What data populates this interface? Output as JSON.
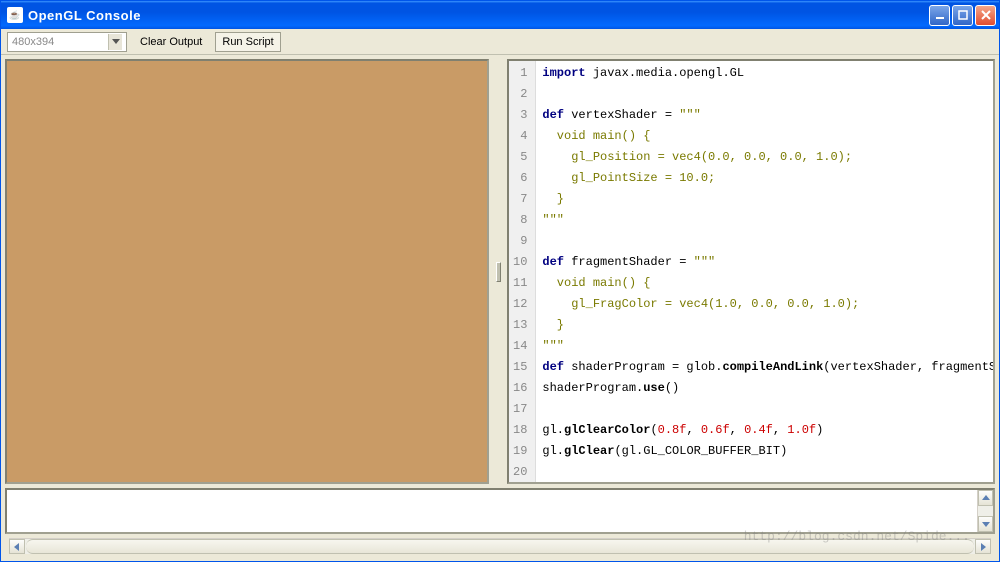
{
  "window": {
    "title": "OpenGL Console",
    "icon": "java-icon"
  },
  "toolbar": {
    "resolution_value": "480x394",
    "clear_label": "Clear Output",
    "run_label": "Run Script"
  },
  "canvas": {
    "bg_color": "#c99b66"
  },
  "code": {
    "lines": [
      {
        "n": 1,
        "segments": [
          {
            "c": "kw",
            "t": "import"
          },
          {
            "c": "",
            "t": " javax.media.opengl.GL"
          }
        ]
      },
      {
        "n": 2,
        "segments": []
      },
      {
        "n": 3,
        "segments": [
          {
            "c": "kw",
            "t": "def"
          },
          {
            "c": "",
            "t": " vertexShader = "
          },
          {
            "c": "str",
            "t": "\"\"\""
          }
        ]
      },
      {
        "n": 4,
        "segments": [
          {
            "c": "str",
            "t": "  void main() {"
          }
        ]
      },
      {
        "n": 5,
        "segments": [
          {
            "c": "str",
            "t": "    gl_Position = vec4(0.0, 0.0, 0.0, 1.0);"
          }
        ]
      },
      {
        "n": 6,
        "segments": [
          {
            "c": "str",
            "t": "    gl_PointSize = 10.0;"
          }
        ]
      },
      {
        "n": 7,
        "segments": [
          {
            "c": "str",
            "t": "  }"
          }
        ]
      },
      {
        "n": 8,
        "segments": [
          {
            "c": "str",
            "t": "\"\"\""
          }
        ]
      },
      {
        "n": 9,
        "segments": []
      },
      {
        "n": 10,
        "segments": [
          {
            "c": "kw",
            "t": "def"
          },
          {
            "c": "",
            "t": " fragmentShader = "
          },
          {
            "c": "str",
            "t": "\"\"\""
          }
        ]
      },
      {
        "n": 11,
        "segments": [
          {
            "c": "str",
            "t": "  void main() {"
          }
        ]
      },
      {
        "n": 12,
        "segments": [
          {
            "c": "str",
            "t": "    gl_FragColor = vec4(1.0, 0.0, 0.0, 1.0);"
          }
        ]
      },
      {
        "n": 13,
        "segments": [
          {
            "c": "str",
            "t": "  }"
          }
        ]
      },
      {
        "n": 14,
        "segments": [
          {
            "c": "str",
            "t": "\"\"\""
          }
        ]
      },
      {
        "n": 15,
        "segments": [
          {
            "c": "kw",
            "t": "def"
          },
          {
            "c": "",
            "t": " shaderProgram = glob."
          },
          {
            "c": "fn",
            "t": "compileAndLink"
          },
          {
            "c": "",
            "t": "(vertexShader, fragmentShader)"
          }
        ]
      },
      {
        "n": 16,
        "segments": [
          {
            "c": "",
            "t": "shaderProgram."
          },
          {
            "c": "fn",
            "t": "use"
          },
          {
            "c": "",
            "t": "()"
          }
        ]
      },
      {
        "n": 17,
        "segments": []
      },
      {
        "n": 18,
        "segments": [
          {
            "c": "",
            "t": "gl."
          },
          {
            "c": "fn",
            "t": "glClearColor"
          },
          {
            "c": "",
            "t": "("
          },
          {
            "c": "num",
            "t": "0.8f"
          },
          {
            "c": "",
            "t": ", "
          },
          {
            "c": "num",
            "t": "0.6f"
          },
          {
            "c": "",
            "t": ", "
          },
          {
            "c": "num",
            "t": "0.4f"
          },
          {
            "c": "",
            "t": ", "
          },
          {
            "c": "num",
            "t": "1.0f"
          },
          {
            "c": "",
            "t": ")"
          }
        ]
      },
      {
        "n": 19,
        "segments": [
          {
            "c": "",
            "t": "gl."
          },
          {
            "c": "fn",
            "t": "glClear"
          },
          {
            "c": "",
            "t": "(gl.GL_COLOR_BUFFER_BIT)"
          }
        ]
      },
      {
        "n": 20,
        "segments": []
      }
    ]
  },
  "watermark": "http://blog.csdn.net/Spide..."
}
